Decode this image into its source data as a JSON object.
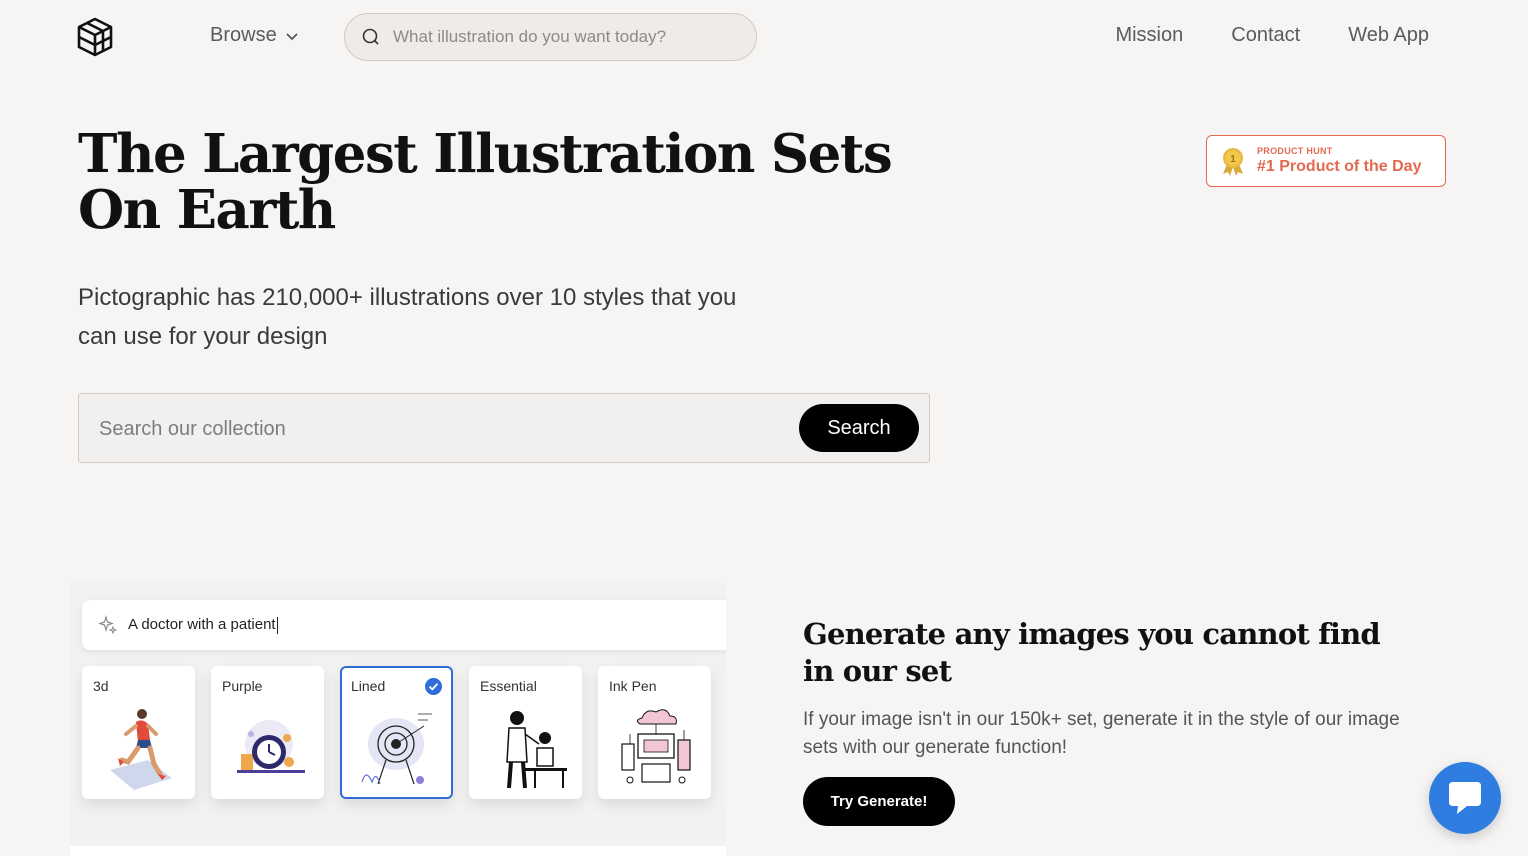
{
  "nav": {
    "browse_label": "Browse",
    "search_placeholder": "What illustration do you want today?",
    "links": [
      "Mission",
      "Contact",
      "Web App"
    ]
  },
  "hero": {
    "title": "The Largest Illustration Sets On Earth",
    "subtitle": "Pictographic has 210,000+ illustrations over 10 styles that you can use for your design",
    "badge_small": "PRODUCT HUNT",
    "badge_big": "#1 Product of the Day",
    "search_placeholder": "Search our collection",
    "search_button": "Search"
  },
  "demo": {
    "prompt": "A doctor with a patient",
    "styles": [
      {
        "label": "3d",
        "selected": false
      },
      {
        "label": "Purple",
        "selected": false
      },
      {
        "label": "Lined",
        "selected": true
      },
      {
        "label": "Essential",
        "selected": false
      },
      {
        "label": "Ink Pen",
        "selected": false
      }
    ]
  },
  "generate": {
    "title": "Generate any images you cannot find in our set",
    "text": "If your image isn't in our 150k+ set, generate it in the style of our image sets with our generate function!",
    "button": "Try Generate!"
  },
  "colors": {
    "accent_blue": "#2f6ed8",
    "badge_orange": "#e36a4e",
    "chat_blue": "#2f7de0"
  }
}
